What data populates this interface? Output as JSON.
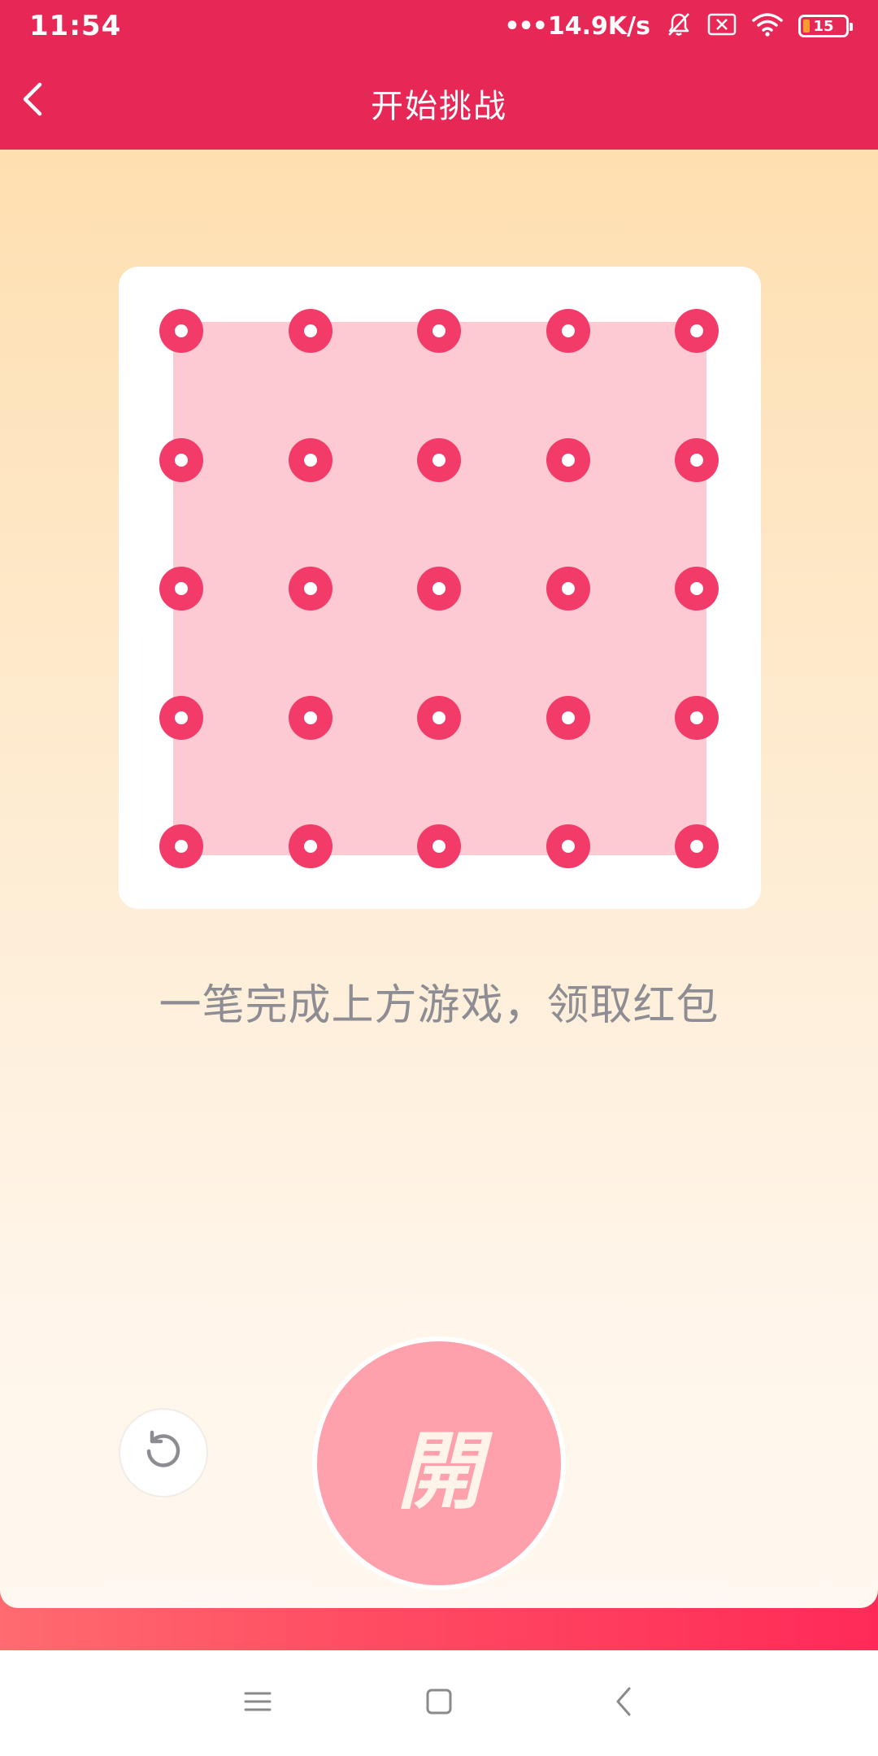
{
  "status_bar": {
    "time": "11:54",
    "network_speed": "14.9K/s",
    "battery_level": "15",
    "icons": [
      "more-dots-icon",
      "bell-muted-icon",
      "sim-x-icon",
      "wifi-icon",
      "battery-icon"
    ]
  },
  "header": {
    "title": "开始挑战",
    "back_icon": "chevron-left-icon"
  },
  "game": {
    "grid_rows": 5,
    "grid_cols": 5,
    "instruction": "一笔完成上方游戏，领取红包"
  },
  "actions": {
    "reset_icon": "refresh-icon",
    "open_label": "開"
  },
  "nav_bar": {
    "icons": [
      "menu-icon",
      "home-icon",
      "back-icon"
    ]
  },
  "colors": {
    "header": "#e72857",
    "dot": "#f23b69",
    "game_area": "#fdc9d3",
    "open_button": "#ffa1ad"
  }
}
